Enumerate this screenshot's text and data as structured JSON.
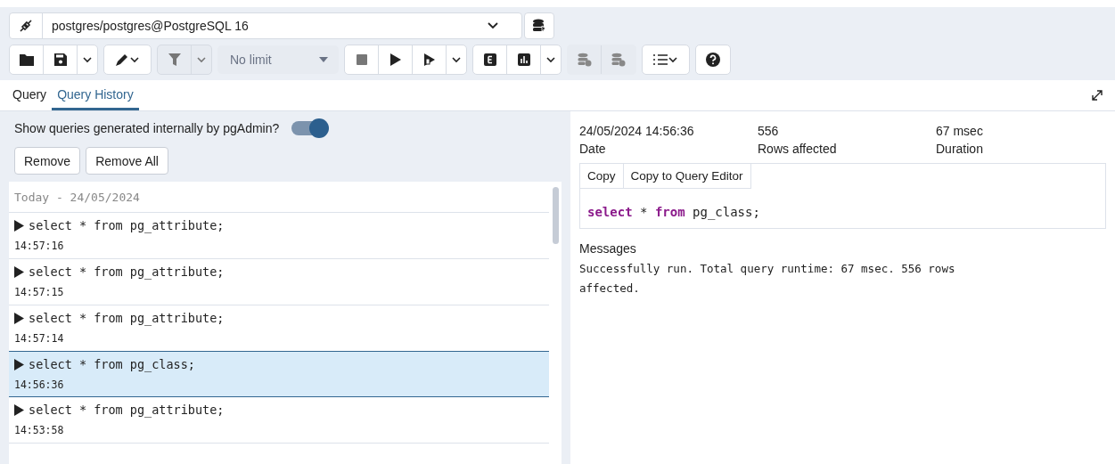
{
  "connection": {
    "label": "postgres/postgres@PostgreSQL 16"
  },
  "toolbar": {
    "row_limit": "No limit"
  },
  "tabs": [
    {
      "label": "Query",
      "selected": false
    },
    {
      "label": "Query History",
      "selected": true
    }
  ],
  "history": {
    "toggle_label": "Show queries generated internally by pgAdmin?",
    "toggle_on": true,
    "buttons": [
      "Remove",
      "Remove All"
    ],
    "group_header": "Today - 24/05/2024",
    "entries": [
      {
        "query": "select * from pg_attribute;",
        "time": "14:57:16",
        "selected": false
      },
      {
        "query": "select * from pg_attribute;",
        "time": "14:57:15",
        "selected": false
      },
      {
        "query": "select * from pg_attribute;",
        "time": "14:57:14",
        "selected": false
      },
      {
        "query": "select * from pg_class;",
        "time": "14:56:36",
        "selected": true
      },
      {
        "query": "select * from pg_attribute;",
        "time": "14:53:58",
        "selected": false
      }
    ]
  },
  "details": {
    "stats": [
      {
        "value": "24/05/2024 14:56:36",
        "label": "Date"
      },
      {
        "value": "556",
        "label": "Rows affected"
      },
      {
        "value": "67 msec",
        "label": "Duration"
      }
    ],
    "buttons": [
      "Copy",
      "Copy to Query Editor"
    ],
    "query_tokens": [
      {
        "text": "select",
        "kind": "keyword"
      },
      {
        "text": " * ",
        "kind": "plain"
      },
      {
        "text": "from",
        "kind": "keyword"
      },
      {
        "text": " pg_class;",
        "kind": "plain"
      }
    ],
    "messages_title": "Messages",
    "messages": "Successfully run. Total query runtime: 67 msec. 556 rows affected."
  }
}
